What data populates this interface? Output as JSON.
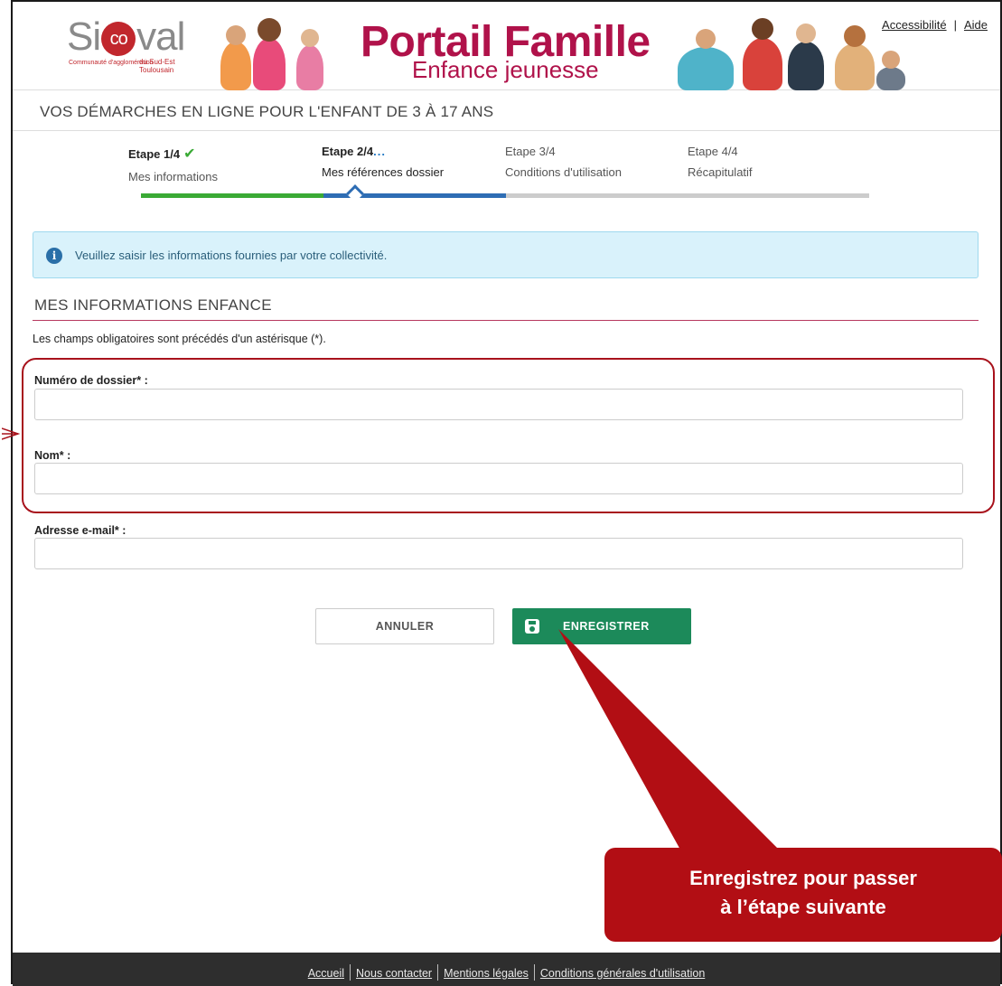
{
  "header": {
    "logo": {
      "brand": "Sicoval",
      "tagline_left": "Communauté d'agglomération",
      "tagline_right": "du Sud-Est Toulousain"
    },
    "portal_title": "Portail Famille",
    "portal_subtitle": "Enfance jeunesse",
    "links": {
      "accessibility": "Accessibilité",
      "separator": "|",
      "help": "Aide"
    }
  },
  "banner_title": "VOS DÉMARCHES EN LIGNE POUR L'ENFANT DE 3 À 17 ANS",
  "stepper": {
    "steps": [
      {
        "number": "Etape 1/4",
        "label": "Mes informations",
        "status": "done"
      },
      {
        "number": "Etape 2/4",
        "label": "Mes références dossier",
        "status": "current",
        "indicator": "..."
      },
      {
        "number": "Etape 3/4",
        "label": "Conditions d'utilisation",
        "status": "todo"
      },
      {
        "number": "Etape 4/4",
        "label": "Récapitulatif",
        "status": "todo"
      }
    ],
    "colors": {
      "done": "#3aaa35",
      "current": "#2e6db4",
      "todo": "#cccccc"
    }
  },
  "info": {
    "icon": "info-icon",
    "text": "Veuillez saisir les informations fournies par votre collectivité."
  },
  "section": {
    "title": "MES INFORMATIONS ENFANCE",
    "mandatory_note": "Les champs obligatoires sont précédés d'un astérisque (*)."
  },
  "form": {
    "dossier_label": "Numéro de dossier* :",
    "dossier_value": "",
    "nom_label": "Nom* :",
    "nom_value": "",
    "email_label": "Adresse e-mail* :",
    "email_value": ""
  },
  "buttons": {
    "cancel": "ANNULER",
    "save": "ENREGISTRER",
    "save_icon": "floppy-disk-icon"
  },
  "callout": {
    "line1": "Enregistrez pour passer",
    "line2": "à l’étape suivante",
    "color": "#b20e14"
  },
  "footer": {
    "links": [
      "Accueil",
      "Nous contacter",
      "Mentions légales",
      "Conditions générales d'utilisation"
    ]
  }
}
